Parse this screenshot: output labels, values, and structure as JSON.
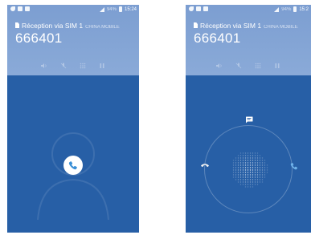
{
  "screens": [
    {
      "status": {
        "battery_pct": "94%",
        "time": "15:24"
      },
      "sim_label": "Réception via SIM 1",
      "carrier": "CHINA MOBILE",
      "number": "666401"
    },
    {
      "status": {
        "battery_pct": "94%",
        "time": "15:2"
      },
      "sim_label": "Réception via SIM 1",
      "carrier": "CHINA MOBILE",
      "number": "666401"
    }
  ],
  "colors": {
    "accent": "#275fa6",
    "header": "#8aaad8",
    "accept": "#3a8fd6"
  },
  "icons": [
    "call-icon",
    "speaker-icon",
    "mute-icon",
    "dialpad-icon",
    "hold-icon",
    "decline-icon",
    "accept-icon",
    "message-icon",
    "sim-icon"
  ]
}
